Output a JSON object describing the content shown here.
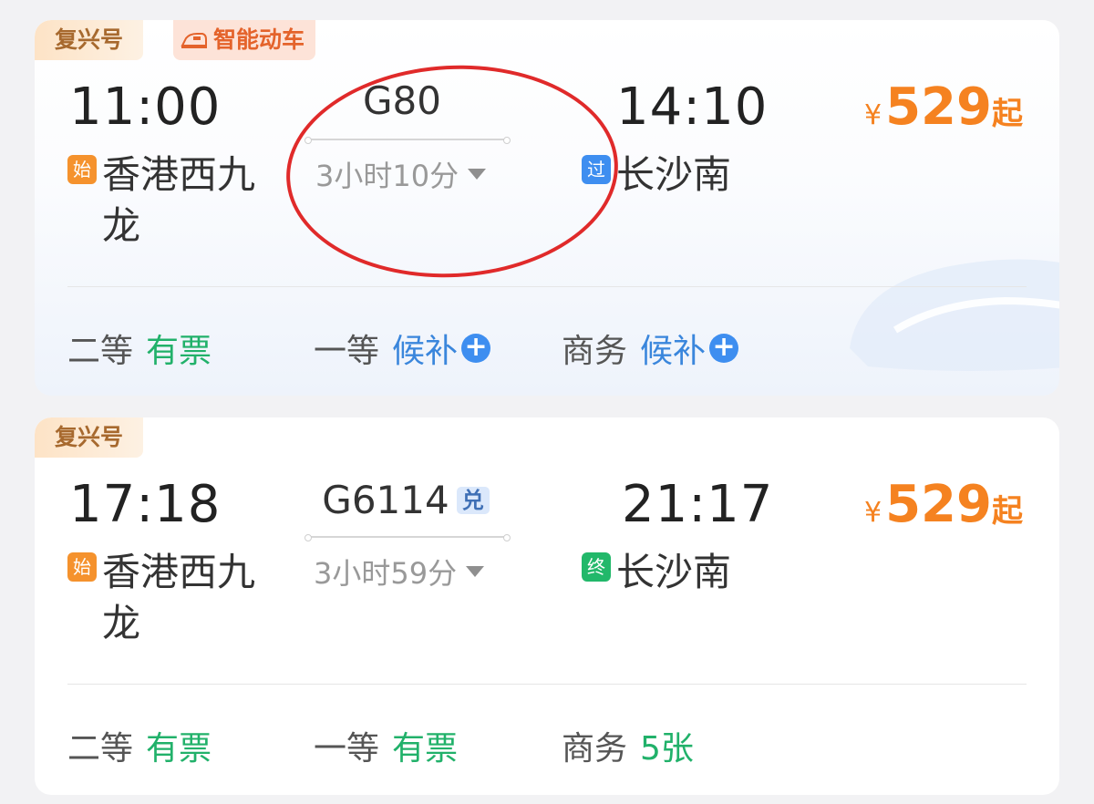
{
  "trains": [
    {
      "tags": {
        "type": "复兴号",
        "smart": "智能动车"
      },
      "depart_time": "11:00",
      "depart_badge": "始",
      "depart_station": "香港西九龙",
      "train_no": "G80",
      "duration": "3小时10分",
      "arrive_time": "14:10",
      "arrive_badge": "过",
      "arrive_station": "长沙南",
      "price": {
        "symbol": "¥",
        "amount": "529",
        "suffix": "起"
      },
      "seats": [
        {
          "class": "二等",
          "status": "有票"
        },
        {
          "class": "一等",
          "status": "候补"
        },
        {
          "class": "商务",
          "status": "候补"
        }
      ]
    },
    {
      "tags": {
        "type": "复兴号"
      },
      "depart_time": "17:18",
      "depart_badge": "始",
      "depart_station": "香港西九龙",
      "train_no": "G6114",
      "train_badge": "兑",
      "duration": "3小时59分",
      "arrive_time": "21:17",
      "arrive_badge": "终",
      "arrive_station": "长沙南",
      "price": {
        "symbol": "¥",
        "amount": "529",
        "suffix": "起"
      },
      "seats": [
        {
          "class": "二等",
          "status": "有票"
        },
        {
          "class": "一等",
          "status": "有票"
        },
        {
          "class": "商务",
          "status": "5张"
        }
      ]
    }
  ],
  "colors": {
    "price": "#f58220",
    "available": "#21b16a",
    "waitlist": "#3a86dc",
    "annotation_circle": "#e02a2a"
  },
  "icons": {
    "smart_tag": "train-icon",
    "waitlist_add": "plus-circle-icon",
    "duration_expand": "caret-down-icon"
  }
}
